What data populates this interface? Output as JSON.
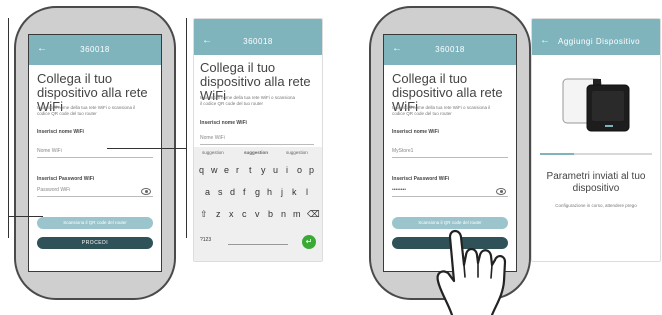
{
  "appbar_title": "360018",
  "statusbar_icons": "▾ ◂ ▮",
  "connect_title": "Collega il tuo dispositivo alla rete WiFi",
  "connect_description": "Inserisci il nome della tua rete WiFi o scansiona il codice QR code del tuo router",
  "network_name_label": "Inserisci nome WiFi",
  "network_name_placeholder": "Nome WiFi",
  "network_name_value": "MyStore1",
  "password_label": "Inserisci Password WiFi",
  "password_placeholder": "Password WiFi",
  "password_value": "••••••••",
  "scan_button_label": "Scansiona il QR code del router",
  "proceed_button_label": "PROCEDI",
  "keyboard": {
    "suggestions": [
      "suggestion",
      "suggestion",
      "suggestion"
    ],
    "row1": [
      "q",
      "w",
      "e",
      "r",
      "t",
      "y",
      "u",
      "i",
      "o",
      "p"
    ],
    "row2": [
      "a",
      "s",
      "d",
      "f",
      "g",
      "h",
      "j",
      "k",
      "l"
    ],
    "row3": [
      "⇧",
      "z",
      "x",
      "c",
      "v",
      "b",
      "n",
      "m",
      "⌫"
    ],
    "row4_left": "?123",
    "enter": "↵"
  },
  "add_device_title": "Aggiungi Dispositivo",
  "params_sent": "Parametri inviati al tuo dispositivo",
  "config_progress_text": "Configurazione in corso, attendere prego",
  "config_progress": 0.3
}
